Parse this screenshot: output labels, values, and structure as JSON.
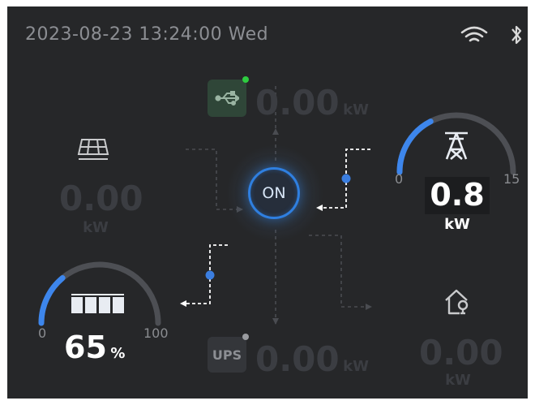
{
  "status_bar": {
    "datetime": "2023-08-23  13:24:00  Wed",
    "wifi_icon": "wifi-icon",
    "bluetooth_icon": "bluetooth-icon"
  },
  "system": {
    "power_label": "ON"
  },
  "usb": {
    "value": "0.00",
    "unit": "kW",
    "status_dot_color": "#2ecc40"
  },
  "solar": {
    "value": "0.00",
    "unit": "kW",
    "icon": "solar-panel-icon"
  },
  "grid": {
    "icon": "power-tower-icon",
    "gauge_min": "0",
    "gauge_max": "15",
    "value": "0.8",
    "unit": "kW",
    "gauge_level_fraction": 0.35
  },
  "battery": {
    "icon": "battery-icon",
    "gauge_min": "0",
    "gauge_max": "100",
    "value": "65",
    "unit": "%",
    "gauge_level_fraction": 0.28
  },
  "ups": {
    "label": "UPS",
    "value": "0.00",
    "unit": "kW",
    "status_dot_color": "#9a9ca0"
  },
  "home": {
    "value": "0.00",
    "unit": "kW",
    "icon": "home-icon"
  },
  "colors": {
    "background": "#262729",
    "accent": "#2f7fe0",
    "inactive_text": "#3b3d42",
    "label_text": "#8a8c90"
  }
}
